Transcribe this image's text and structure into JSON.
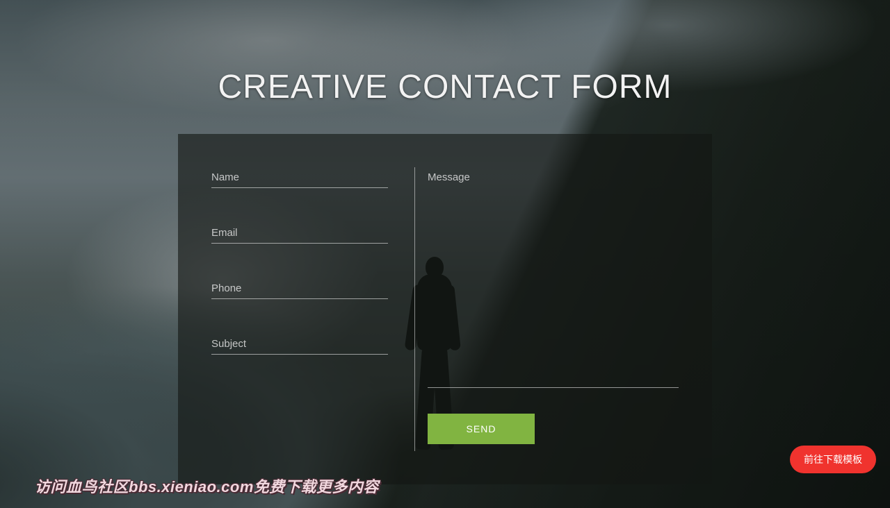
{
  "header": {
    "title": "CREATIVE CONTACT FORM"
  },
  "form": {
    "name": {
      "placeholder": "Name",
      "value": ""
    },
    "email": {
      "placeholder": "Email",
      "value": ""
    },
    "phone": {
      "placeholder": "Phone",
      "value": ""
    },
    "subject": {
      "placeholder": "Subject",
      "value": ""
    },
    "message": {
      "placeholder": "Message",
      "value": ""
    },
    "submit_label": "SEND"
  },
  "overlay": {
    "download_label": "前往下载模板",
    "promo_text": "访问血鸟社区bbs.xieniao.com免费下载更多内容"
  }
}
